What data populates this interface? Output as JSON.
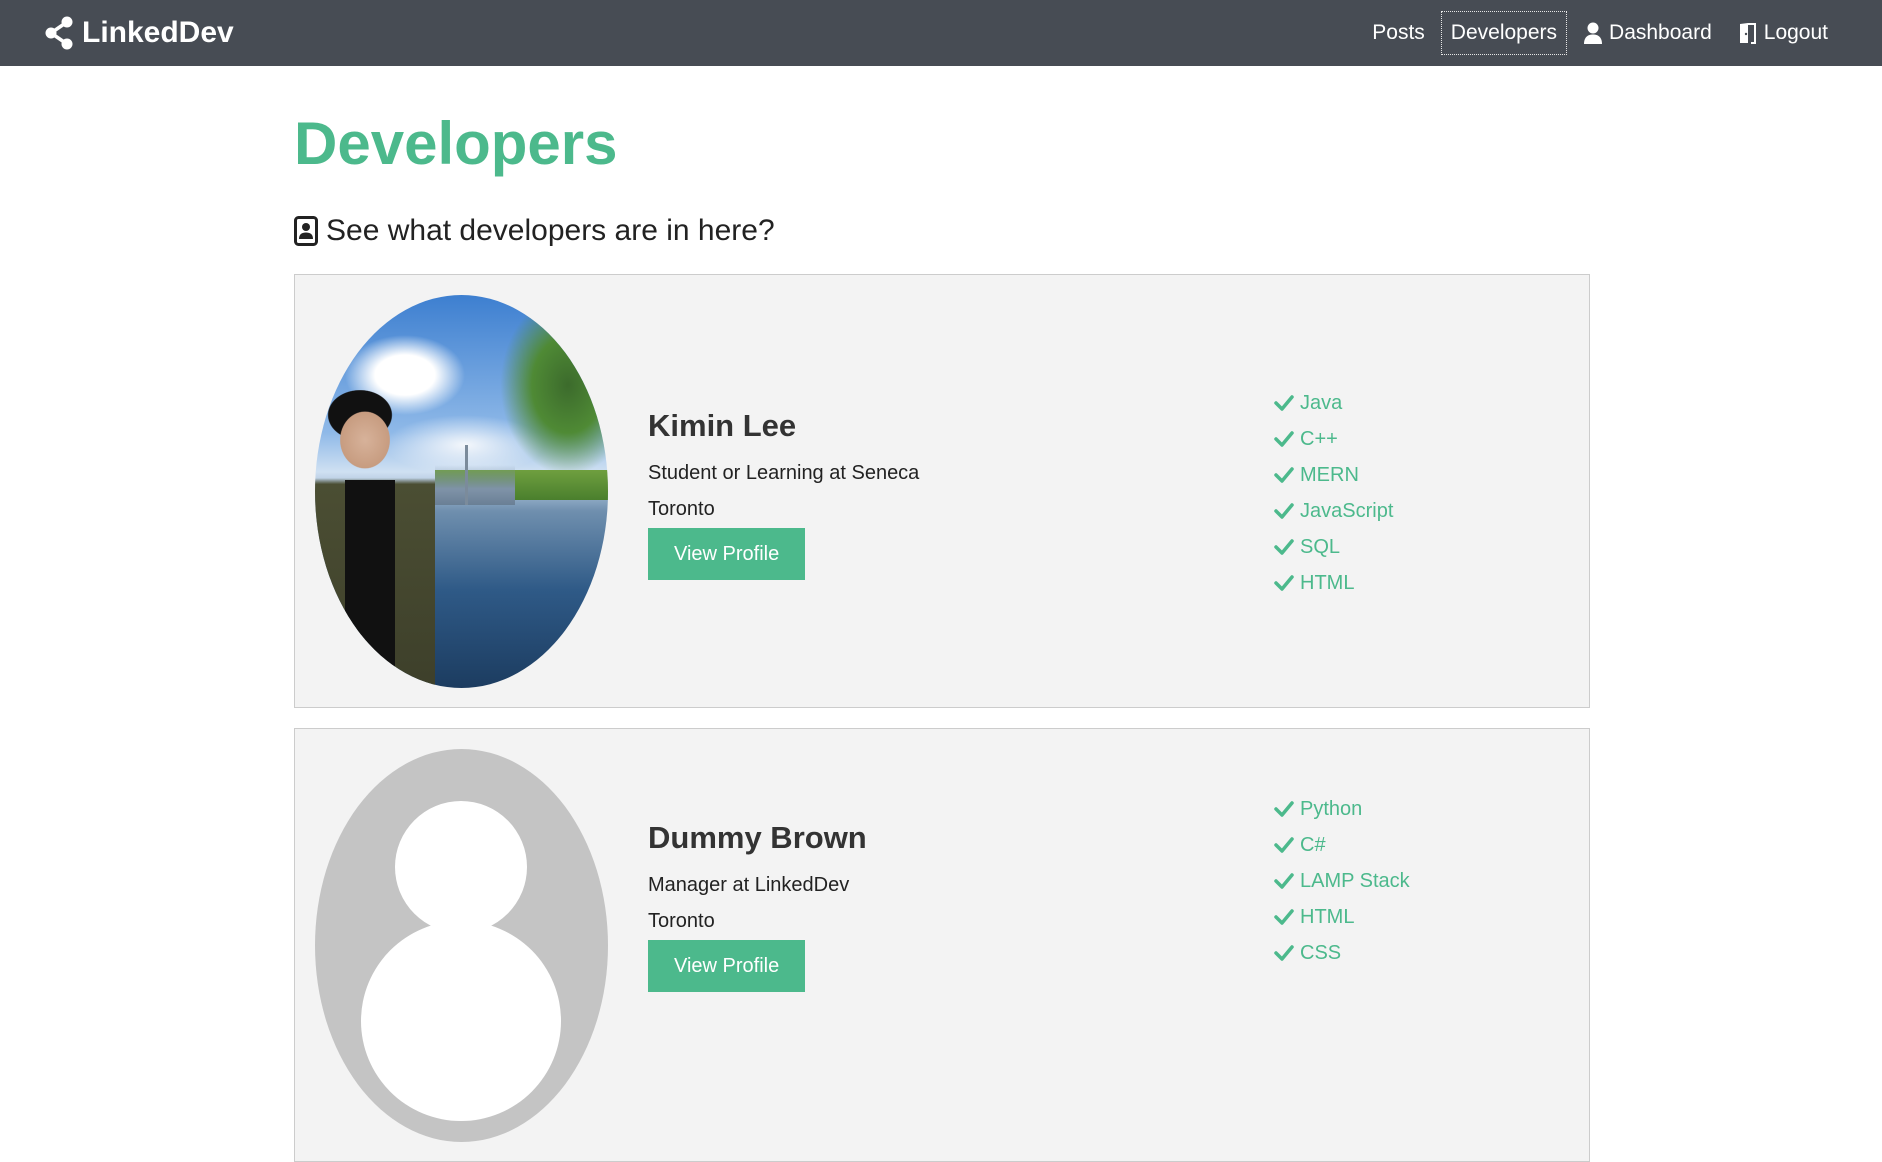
{
  "navbar": {
    "brand": "LinkedDev",
    "links": [
      {
        "label": "Posts",
        "icon": "none",
        "active": false
      },
      {
        "label": "Developers",
        "icon": "none",
        "active": true
      },
      {
        "label": "Dashboard",
        "icon": "user-icon",
        "active": false
      },
      {
        "label": "Logout",
        "icon": "door-exit-icon",
        "active": false
      }
    ]
  },
  "page": {
    "title": "Developers",
    "subtitle": "See what developers are in here?",
    "subtitle_icon": "contact-card-icon"
  },
  "profiles": [
    {
      "name": "Kimin Lee",
      "status": "Student or Learning at Seneca",
      "location": "Toronto",
      "button": "View Profile",
      "avatar": "photo",
      "skills": [
        "Java",
        "C++",
        "MERN",
        "JavaScript",
        "SQL",
        "HTML"
      ]
    },
    {
      "name": "Dummy Brown",
      "status": "Manager at LinkedDev",
      "location": "Toronto",
      "button": "View Profile",
      "avatar": "placeholder",
      "skills": [
        "Python",
        "C#",
        "LAMP Stack",
        "HTML",
        "CSS"
      ]
    }
  ],
  "colors": {
    "navbar_bg": "#474c54",
    "accent": "#4cb98c",
    "card_bg": "#f3f3f3"
  }
}
